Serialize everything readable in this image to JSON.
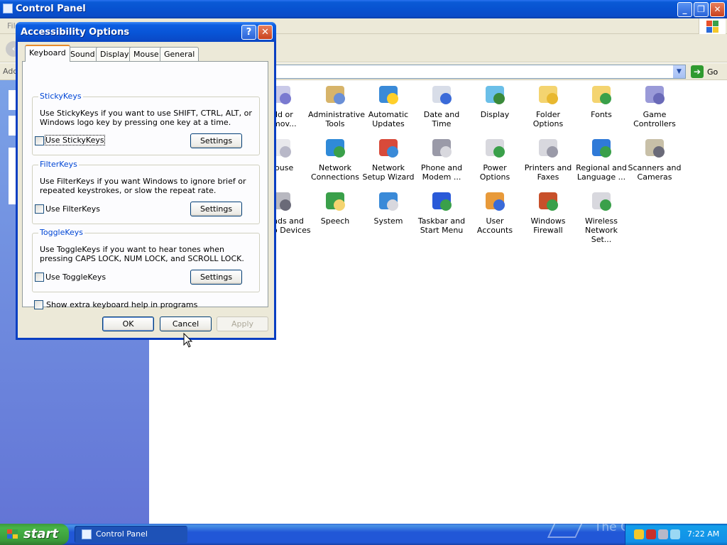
{
  "cp_window": {
    "title": "Control Panel",
    "menu_file": "Fil",
    "address_label": "Add",
    "go_label": "Go"
  },
  "cp_items": [
    {
      "name": "add-remove-programs",
      "label": "dd or\nmov...",
      "c1": "#c9c9e8",
      "c2": "#7a7ad0"
    },
    {
      "name": "administrative-tools",
      "label": "Administrative Tools",
      "c1": "#d7b46a",
      "c2": "#6a8fd6"
    },
    {
      "name": "automatic-updates",
      "label": "Automatic Updates",
      "c1": "#3a8ad8",
      "c2": "#ffcf2a"
    },
    {
      "name": "date-and-time",
      "label": "Date and Time",
      "c1": "#d8dde8",
      "c2": "#3a6ad8"
    },
    {
      "name": "display",
      "label": "Display",
      "c1": "#6bbfe8",
      "c2": "#3a8a3a"
    },
    {
      "name": "folder-options",
      "label": "Folder Options",
      "c1": "#f4d470",
      "c2": "#e8b830"
    },
    {
      "name": "fonts",
      "label": "Fonts",
      "c1": "#f4d470",
      "c2": "#3aa04a"
    },
    {
      "name": "game-controllers",
      "label": "Game Controllers",
      "c1": "#9a9ad8",
      "c2": "#6a6ab8"
    },
    {
      "name": "mouse",
      "label": "louse",
      "c1": "#e8e8ec",
      "c2": "#b8b8c8"
    },
    {
      "name": "network-connections",
      "label": "Network Connections",
      "c1": "#2f8ad8",
      "c2": "#3aa04a"
    },
    {
      "name": "network-setup-wizard",
      "label": "Network Setup Wizard",
      "c1": "#d84a3a",
      "c2": "#3a8ad8"
    },
    {
      "name": "phone-and-modem",
      "label": "Phone and Modem ...",
      "c1": "#9a9aa8",
      "c2": "#d8d8de"
    },
    {
      "name": "power-options",
      "label": "Power Options",
      "c1": "#d8d8de",
      "c2": "#3aa04a"
    },
    {
      "name": "printers-and-faxes",
      "label": "Printers and Faxes",
      "c1": "#d8d8de",
      "c2": "#9a9aa8"
    },
    {
      "name": "regional-and-language",
      "label": "Regional and Language ...",
      "c1": "#2f7ad8",
      "c2": "#3aa04a"
    },
    {
      "name": "scanners-and-cameras",
      "label": "Scanners and Cameras",
      "c1": "#c8c0a8",
      "c2": "#6a6a78"
    },
    {
      "name": "sounds-and-audio",
      "label": "nds and\no Devices",
      "c1": "#b8b8c0",
      "c2": "#6a6a78"
    },
    {
      "name": "speech",
      "label": "Speech",
      "c1": "#3aa04a",
      "c2": "#f4d470"
    },
    {
      "name": "system",
      "label": "System",
      "c1": "#3a8ad8",
      "c2": "#d8d8de"
    },
    {
      "name": "taskbar-and-start-menu",
      "label": "Taskbar and Start Menu",
      "c1": "#2a5ad8",
      "c2": "#3aa04a"
    },
    {
      "name": "user-accounts",
      "label": "User Accounts",
      "c1": "#e89a3a",
      "c2": "#3a6ad8"
    },
    {
      "name": "windows-firewall",
      "label": "Windows Firewall",
      "c1": "#c8502a",
      "c2": "#3aa04a"
    },
    {
      "name": "wireless-network-setup",
      "label": "Wireless Network Set...",
      "c1": "#d8d8de",
      "c2": "#3aa04a"
    }
  ],
  "dialog": {
    "title": "Accessibility Options",
    "help_glyph": "?",
    "close_glyph": "✕",
    "tabs": [
      "Keyboard",
      "Sound",
      "Display",
      "Mouse",
      "General"
    ],
    "active_tab": "Keyboard",
    "groups": {
      "stickykeys": {
        "title": "StickyKeys",
        "desc": "Use StickyKeys if you want to use SHIFT, CTRL, ALT, or Windows logo key by pressing one key at a time.",
        "checkbox": "Use StickyKeys",
        "button": "Settings"
      },
      "filterkeys": {
        "title": "FilterKeys",
        "desc": "Use FilterKeys if you want Windows to ignore brief or repeated keystrokes, or slow the repeat rate.",
        "checkbox": "Use FilterKeys",
        "button": "Settings"
      },
      "togglekeys": {
        "title": "ToggleKeys",
        "desc": "Use ToggleKeys if you want to hear tones when pressing CAPS LOCK, NUM LOCK, and SCROLL LOCK.",
        "checkbox": "Use ToggleKeys",
        "button": "Settings"
      }
    },
    "extra_help": "Show extra keyboard help in programs",
    "ok": "OK",
    "cancel": "Cancel",
    "apply": "Apply"
  },
  "taskbar": {
    "start": "start",
    "task_item": "Control Panel",
    "watermark": "The Collection Book",
    "clock": "7:22 AM"
  },
  "colors": {
    "xp_blue": "#0a5ad6",
    "tab_accent": "#e68b2c",
    "group_title": "#0046d5",
    "start_green": "#3a9a3a"
  }
}
